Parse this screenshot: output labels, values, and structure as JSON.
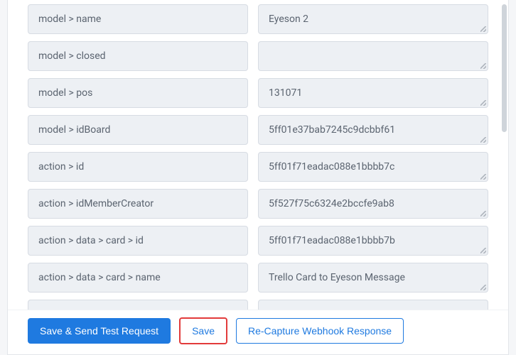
{
  "fields": [
    {
      "label": "model > name",
      "value": "Eyeson 2"
    },
    {
      "label": "model > closed",
      "value": ""
    },
    {
      "label": "model > pos",
      "value": "131071"
    },
    {
      "label": "model > idBoard",
      "value": "5ff01e37bab7245c9dcbbf61"
    },
    {
      "label": "action > id",
      "value": "5ff01f71eadac088e1bbbb7c"
    },
    {
      "label": "action > idMemberCreator",
      "value": "5f527f75c6324e2bccfe9ab8"
    },
    {
      "label": "action > data > card > id",
      "value": "5ff01f71eadac088e1bbbb7b"
    },
    {
      "label": "action > data > card > name",
      "value": "Trello Card to Eyeson Message"
    }
  ],
  "partial": {
    "label": "",
    "value": ""
  },
  "buttons": {
    "save_send": "Save & Send Test Request",
    "save": "Save",
    "recapture": "Re-Capture Webhook Response"
  }
}
